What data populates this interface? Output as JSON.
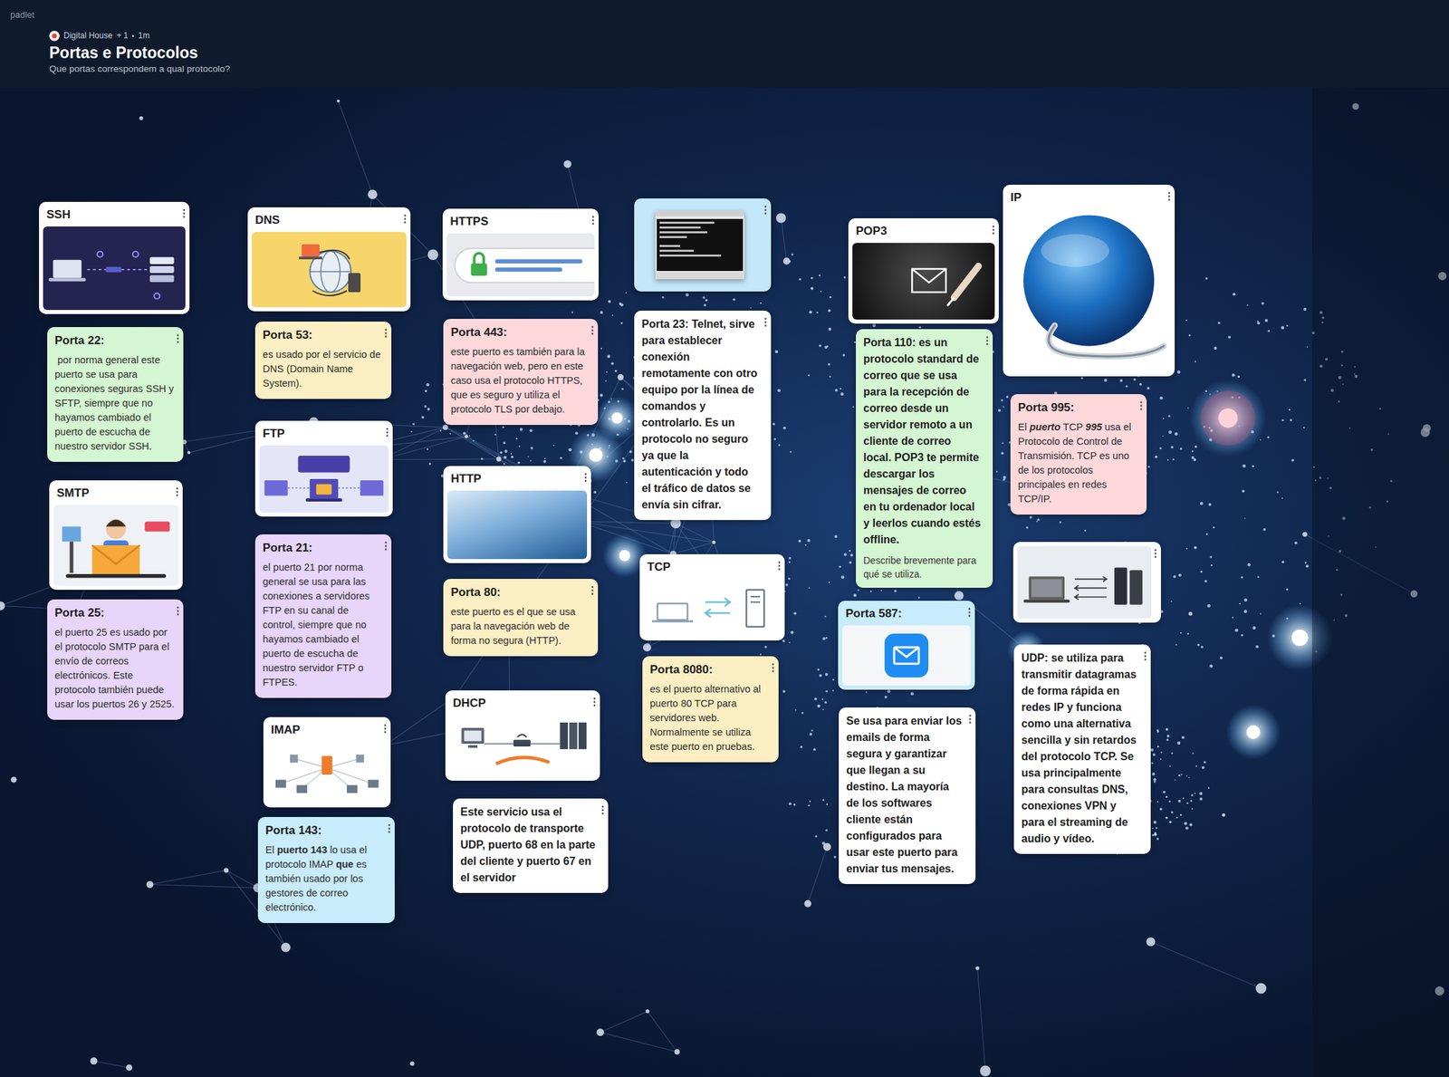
{
  "app": "padlet",
  "header": {
    "author": "Digital House",
    "plus": "+",
    "count": "1",
    "age": "1m",
    "title": "Portas e Protocolos",
    "subtitle": "Que portas correspondem a qual protocolo?"
  },
  "cards": [
    {
      "kind": "image",
      "title": "SSH",
      "color": "#ffffff"
    },
    {
      "kind": "text",
      "title": "Porta 22:",
      "body": " por norma general este puerto se usa para conexiones seguras SSH y SFTP, siempre que no hayamos cambiado el puerto de escucha de nuestro servidor SSH.",
      "color": "#d5f6d2"
    },
    {
      "kind": "image",
      "title": "SMTP",
      "color": "#ffffff"
    },
    {
      "kind": "text",
      "title": "Porta 25:",
      "body": "el puerto 25 es usado por el protocolo SMTP para el envío de correos electrónicos. Este protocolo también puede usar los puertos 26 y 2525.",
      "color": "#e7d5fa"
    },
    {
      "kind": "image",
      "title": "DNS",
      "color": "#ffffff"
    },
    {
      "kind": "text",
      "title": "Porta 53:",
      "body": "es usado por el servicio de DNS (Domain Name System).",
      "color": "#fcefc3"
    },
    {
      "kind": "image",
      "title": "FTP",
      "color": "#ffffff"
    },
    {
      "kind": "text",
      "title": "Porta 21:",
      "body": "el puerto 21 por norma general se usa para las conexiones a servidores FTP en su canal de control, siempre que no hayamos cambiado el puerto de escucha de nuestro servidor FTP o FTPES.",
      "color": "#e7d5fa"
    },
    {
      "kind": "image",
      "title": "IMAP",
      "color": "#ffffff"
    },
    {
      "kind": "text",
      "title": "Porta 143:",
      "body": [
        {
          "text": "El ",
          "bold": false,
          "italic": false
        },
        {
          "text": "puerto 143",
          "bold": true,
          "italic": false
        },
        {
          "text": " lo usa el protocolo IMAP ",
          "bold": false,
          "italic": false
        },
        {
          "text": "que",
          "bold": true,
          "italic": false
        },
        {
          "text": " es también usado por los gestores de correo electrónico.",
          "bold": false,
          "italic": false
        }
      ],
      "color": "#c8ecfc"
    },
    {
      "kind": "image",
      "title": "HTTPS",
      "color": "#ffffff"
    },
    {
      "kind": "text",
      "title": "Porta 443:",
      "body": "este puerto es también para la navegación web, pero en este caso usa el protocolo HTTPS, que es seguro y utiliza el protocolo TLS por debajo.",
      "color": "#fcd8db"
    },
    {
      "kind": "image",
      "title": "HTTP",
      "color": "#ffffff"
    },
    {
      "kind": "text",
      "title": "Porta 80:",
      "body": "este puerto es el que se usa para la navegación web de forma no segura (HTTP).",
      "color": "#fcefc3"
    },
    {
      "kind": "image",
      "title": "DHCP",
      "color": "#ffffff"
    },
    {
      "kind": "bold",
      "body": "Este servicio usa el protocolo de transporte UDP, puerto 68 en la parte del cliente y puerto 67 en el servidor",
      "color": "#ffffff"
    },
    {
      "kind": "picture",
      "color": "#c5e7fa"
    },
    {
      "kind": "bold",
      "body": "Porta 23: Telnet, sirve para establecer conexión remotamente con otro equipo por la línea de comandos y controlarlo. Es un protocolo no seguro ya que la autenticación y todo el tráfico de datos se envía sin cifrar.",
      "color": "#ffffff"
    },
    {
      "kind": "image",
      "title": "TCP",
      "color": "#ffffff"
    },
    {
      "kind": "text",
      "title": "Porta 8080:",
      "body": "es el puerto alternativo al puerto 80 TCP para servidores web. Normalmente se utiliza este puerto en pruebas.",
      "color": "#fcefc3"
    },
    {
      "kind": "image",
      "title": "POP3",
      "color": "#ffffff"
    },
    {
      "kind": "bold",
      "body": "Porta 110: es un protocolo standard de correo que se usa para la recepción de correo desde un servidor remoto a un cliente de correo local. POP3 te permite descargar los mensajes de correo en tu ordenador local y leerlos cuando estés offline.",
      "note": "Describe brevemente para qué se utiliza.",
      "color": "#d5f6d2"
    },
    {
      "kind": "image",
      "title": "Porta 587:",
      "color": "#c8ecfc"
    },
    {
      "kind": "bold",
      "body": "Se usa para enviar los emails de forma segura y garantizar que llegan a su destino. La mayoría de los softwares cliente están configurados para usar este puerto para enviar tus mensajes.",
      "color": "#ffffff"
    },
    {
      "kind": "image",
      "title": "IP",
      "color": "#ffffff"
    },
    {
      "kind": "text",
      "title": "Porta 995:",
      "body": [
        {
          "text": "El ",
          "bold": false,
          "italic": false
        },
        {
          "text": "puerto",
          "bold": true,
          "italic": true
        },
        {
          "text": " TCP ",
          "bold": false,
          "italic": false
        },
        {
          "text": "995",
          "bold": true,
          "italic": true
        },
        {
          "text": " usa el Protocolo de Control de Transmisión. TCP es uno de los protocolos principales en redes TCP/IP.",
          "bold": false,
          "italic": false
        }
      ],
      "color": "#fcd8db"
    },
    {
      "kind": "picture",
      "color": "#ffffff"
    },
    {
      "kind": "bold",
      "body": "UDP: se utiliza para transmitir datagramas de forma rápida en redes IP y funciona como una alternativa sencilla y sin retardos del protocolo TCP. Se usa principalmente para consultas DNS, conexiones VPN y para el streaming de audio y vídeo.",
      "color": "#ffffff"
    }
  ]
}
